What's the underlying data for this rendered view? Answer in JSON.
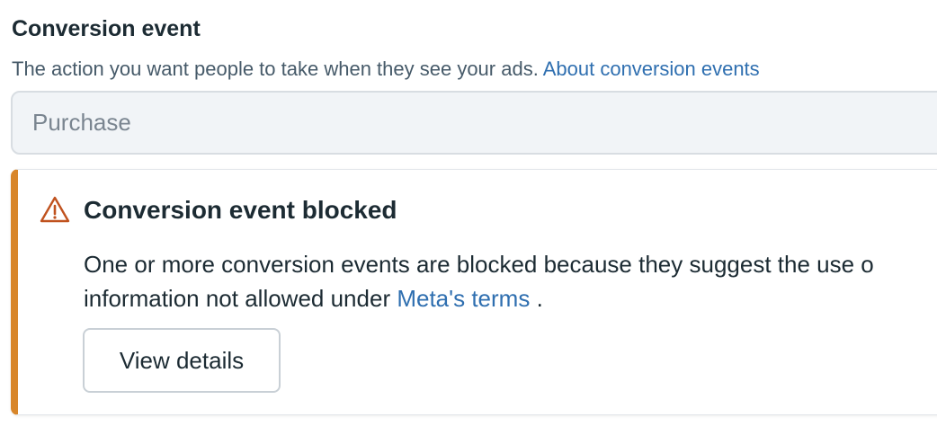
{
  "conversion_event": {
    "title": "Conversion event",
    "description": "The action you want people to take when they see your ads.",
    "link_label": "About conversion events",
    "field_placeholder": "Purchase"
  },
  "alert": {
    "icon": "warning-triangle-icon",
    "accent_color": "#d8862a",
    "title": "Conversion event blocked",
    "body_line1": "One or more conversion events are blocked because they suggest the use o",
    "body_line2_prefix": "information not allowed under",
    "body_link": "Meta's terms",
    "body_suffix": ".",
    "button_label": "View details"
  },
  "colors": {
    "link": "#2f6fb0",
    "text": "#1c2b33",
    "field_bg": "#f1f4f7"
  }
}
